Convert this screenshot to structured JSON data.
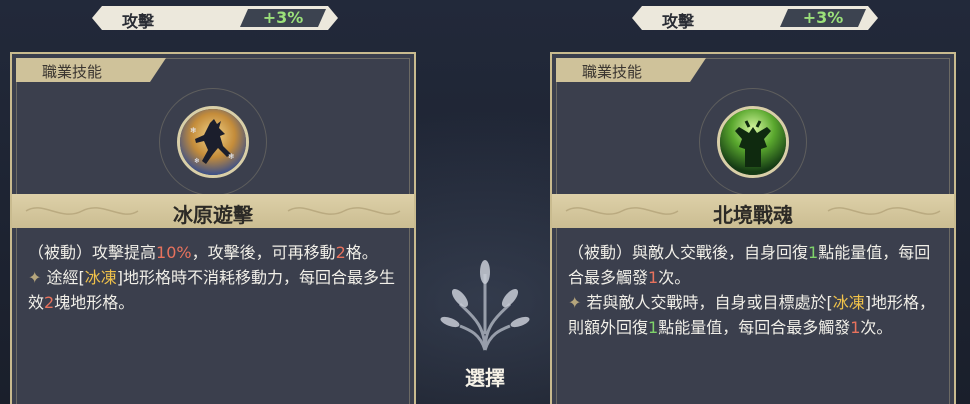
{
  "left": {
    "stat": {
      "label": "攻擊",
      "value": "+3%"
    },
    "tab_label": "職業技能",
    "skill_name": "冰原遊擊",
    "icon": "ice-runner-icon",
    "desc": {
      "line1_a": "（被動）攻擊提高",
      "line1_b": "10%",
      "line1_c": "，攻擊後，可再移動",
      "line1_d": "2",
      "line1_e": "格。",
      "line2_a": "途經[",
      "line2_b": "冰凍",
      "line2_c": "]地形格時不消耗移動力，每回合最多生效",
      "line2_d": "2",
      "line2_e": "塊地形格。"
    }
  },
  "right": {
    "stat": {
      "label": "攻擊",
      "value": "+3%"
    },
    "tab_label": "職業技能",
    "skill_name": "北境戰魂",
    "icon": "warrior-spirit-icon",
    "desc": {
      "line1_a": "（被動）與敵人交戰後，自身回復",
      "line1_b": "1",
      "line1_c": "點能量值，每回合最多觸發",
      "line1_d": "1",
      "line1_e": "次。",
      "line2_a": "若與敵人交戰時，自身或目標處於[",
      "line2_b": "冰凍",
      "line2_c": "]地形格，則額外回復",
      "line2_d": "1",
      "line2_e": "點能量值，每回合最多觸發",
      "line2_f": "1",
      "line2_g": "次。"
    }
  },
  "select_label": "選擇",
  "colors": {
    "highlight_red": "#e8725d",
    "highlight_yellow": "#f0c24a",
    "highlight_green": "#7fd36a",
    "stat_green": "#9be07a",
    "gold": "#c9bb8f"
  }
}
